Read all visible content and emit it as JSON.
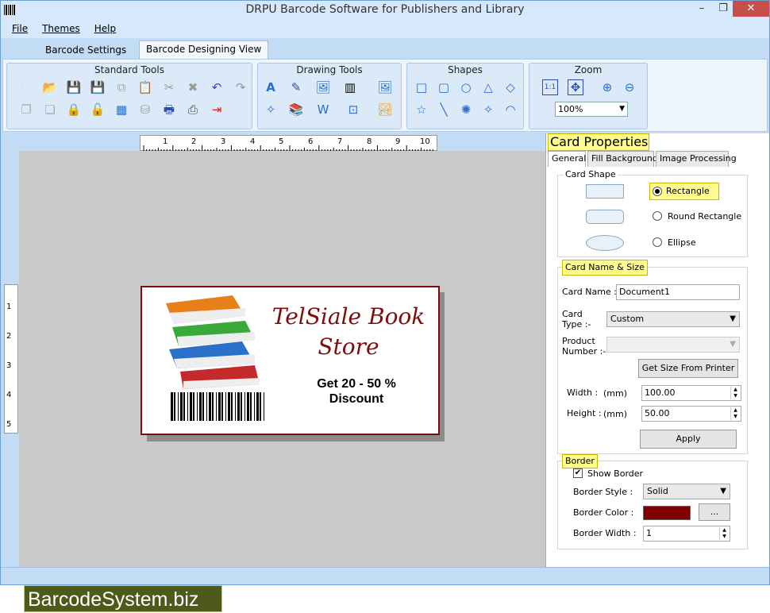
{
  "window": {
    "title": "DRPU Barcode Software for Publishers and Library",
    "controls": {
      "min": "–",
      "max": "❐",
      "close": "✕"
    }
  },
  "menu": [
    "File",
    "Themes",
    "Help"
  ],
  "main_tabs": [
    "Barcode Settings",
    "Barcode Designing View"
  ],
  "ribbon": {
    "standard_tools": "Standard Tools",
    "drawing_tools": "Drawing Tools",
    "shapes": "Shapes",
    "zoom": {
      "label": "Zoom",
      "value": "100%",
      "fit_label": "1:1"
    }
  },
  "rulers": {
    "h": [
      "1",
      "2",
      "3",
      "4",
      "5",
      "6",
      "7",
      "8",
      "9",
      "10"
    ],
    "v": [
      "1",
      "2",
      "3",
      "4",
      "5"
    ]
  },
  "card": {
    "title_line1": "TelSiale Book",
    "title_line2": "Store",
    "discount_line1": "Get 20 - 50 %",
    "discount_line2": "Discount",
    "border_color": "#7d0d0d"
  },
  "panel": {
    "title": "Card Properties",
    "tabs": [
      "General",
      "Fill Background",
      "Image Processing"
    ],
    "card_shape": {
      "legend": "Card Shape",
      "options": [
        "Rectangle",
        "Round Rectangle",
        "Ellipse"
      ],
      "selected": "Rectangle"
    },
    "name_size": {
      "legend": "Card  Name & Size",
      "card_name_label": "Card Name :",
      "card_name_value": "Document1",
      "card_type_label1": "Card",
      "card_type_label2": "Type :-",
      "card_type_value": "Custom",
      "product_label1": "Product",
      "product_label2": "Number :-",
      "get_size_button": "Get Size From Printer",
      "width_label": "Width :",
      "height_label": "Height :",
      "unit": "(mm)",
      "width_value": "100.00",
      "height_value": "50.00",
      "apply_button": "Apply"
    },
    "border": {
      "legend": "Border",
      "show_border_label": "Show Border",
      "show_border_checked": true,
      "style_label": "Border Style :",
      "style_value": "Solid",
      "color_label": "Border Color :",
      "color_value": "#800000",
      "browse_button": "...",
      "width_label": "Border Width :",
      "width_value": "1"
    }
  },
  "brand": "BarcodeSystem.biz"
}
